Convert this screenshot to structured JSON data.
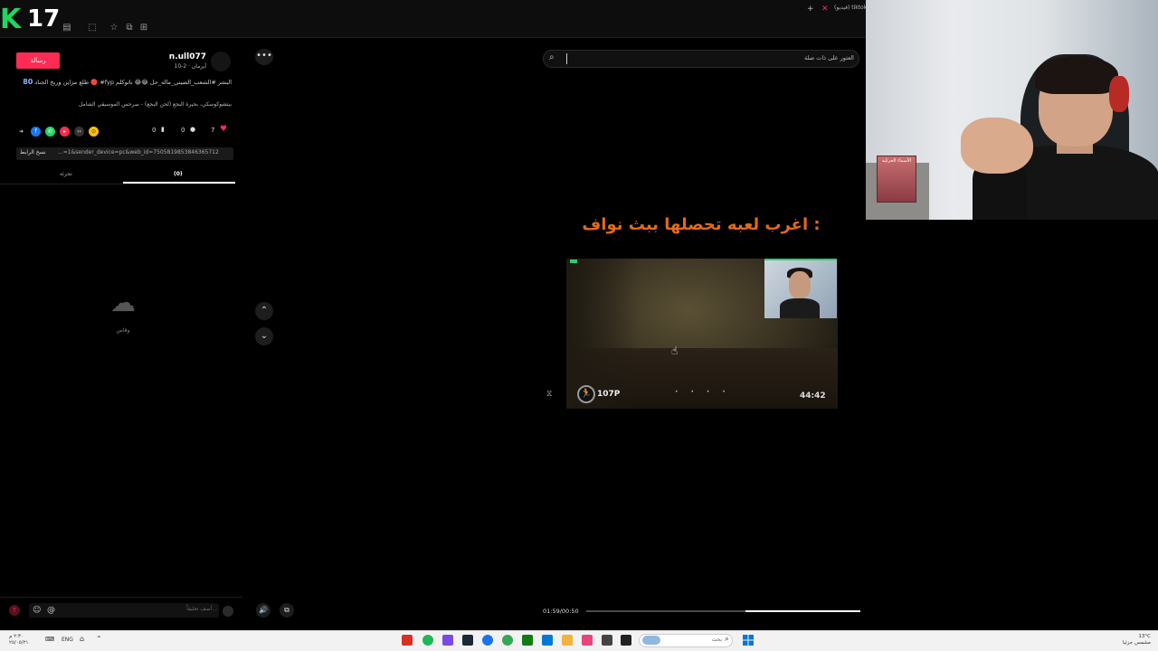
{
  "topbar": {
    "logo_letter": "K",
    "logo_number": "17",
    "right_text": "(فيديو) tiktok"
  },
  "post": {
    "follow_label": "رسالة",
    "username": "n.ull077",
    "date": "أيرمان · 2-10",
    "caption_text": "طلع مزاين وربح الجناد 🔴 #fyp البشر #الشعب_الصيني_ماله_حل 😂😂 تاتوكلم",
    "caption_count": "80",
    "music": "بيتشوكوسكي، بحيرة البجع (لحن البجع) - سرحس الموسيقي الشامل",
    "actions": {
      "likes": "7",
      "comments": "0",
      "saves": "0"
    },
    "copy_link_label": "نسخ الرابط",
    "link_url": "...=1&sender_device=pc&web_id=7505819853846365712",
    "tab_other": "تجزئة",
    "tab_comments": "(0)",
    "empty_text": "وقاس",
    "comment_placeholder": "أضف تعليقاً..."
  },
  "video": {
    "search_placeholder": "العثور على ذات صلة",
    "title": "اغرب لعبه تحصلها ببث نواف :",
    "hud_points": "107P",
    "hud_timer": "44:42",
    "hud_dots": "• • • •",
    "time_label": "01:59/00:50",
    "progress": 0.42
  },
  "webcam": {
    "book_title": "الأسماء الحركية"
  },
  "taskbar": {
    "lang": "ENG",
    "search_label": "بحث",
    "time_line1": "13°C",
    "time_line2": "مشمس جزئيا",
    "weather_line1": "٢:٣٠ م",
    "weather_line2": "٢٥/٠٥/٢١"
  },
  "colors": {
    "accent": "#fe2c55",
    "title_orange": "#e06a1c",
    "logo_green": "#1ed760"
  }
}
